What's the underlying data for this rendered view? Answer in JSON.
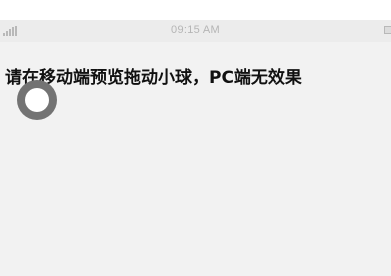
{
  "status_bar": {
    "time": "09:15 AM",
    "signal_icon": "signal-icon",
    "battery_icon": "battery-icon"
  },
  "page": {
    "title": "请在移动端预览拖动小球，PC端无效果"
  },
  "ball": {
    "icon": "draggable-ball",
    "ring_color": "#5a5a5a",
    "fill_color": "#ffffff"
  },
  "colors": {
    "page_background": "#f2f2f2",
    "status_bar_background": "#ececec",
    "status_text": "#b5b5b5"
  }
}
